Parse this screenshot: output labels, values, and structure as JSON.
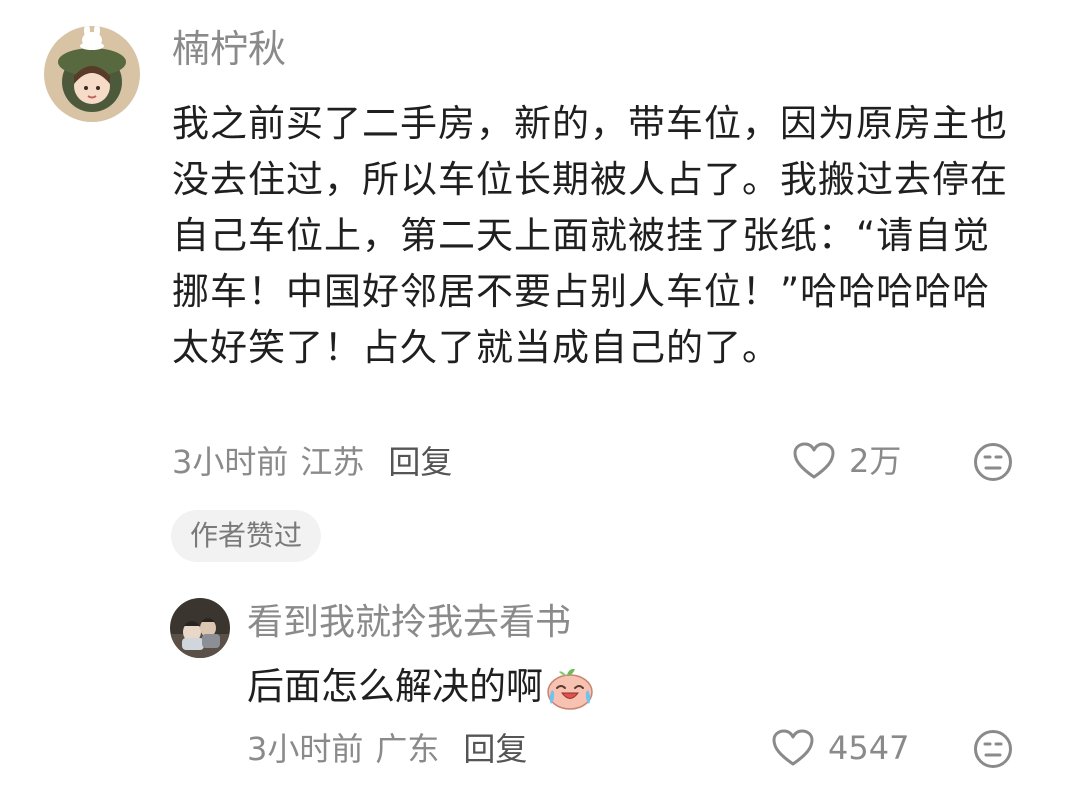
{
  "comment": {
    "username": "楠柠秋",
    "text": "我之前买了二手房，新的，带车位，因为原房主也没去住过，所以车位长期被人占了。我搬过去停在自己车位上，第二天上面就被挂了张纸：“请自觉挪车！中国好邻居不要占别人车位！”哈哈哈哈哈太好笑了！占久了就当成自己的了。",
    "time": "3小时前",
    "location": "江苏",
    "reply_label": "回复",
    "likes": "2万",
    "author_badge": "作者赞过"
  },
  "reply": {
    "username": "看到我就拎我去看书",
    "text": "后面怎么解决的啊",
    "emoji": "crying-laughing-emoji",
    "time": "3小时前",
    "location": "广东",
    "reply_label": "回复",
    "likes": "4547"
  },
  "icons": {
    "like": "heart-icon",
    "dislike": "meh-face-icon"
  },
  "colors": {
    "text": "#1f1f1f",
    "meta": "#8a8a8a",
    "badge_bg": "#f2f2f2"
  }
}
